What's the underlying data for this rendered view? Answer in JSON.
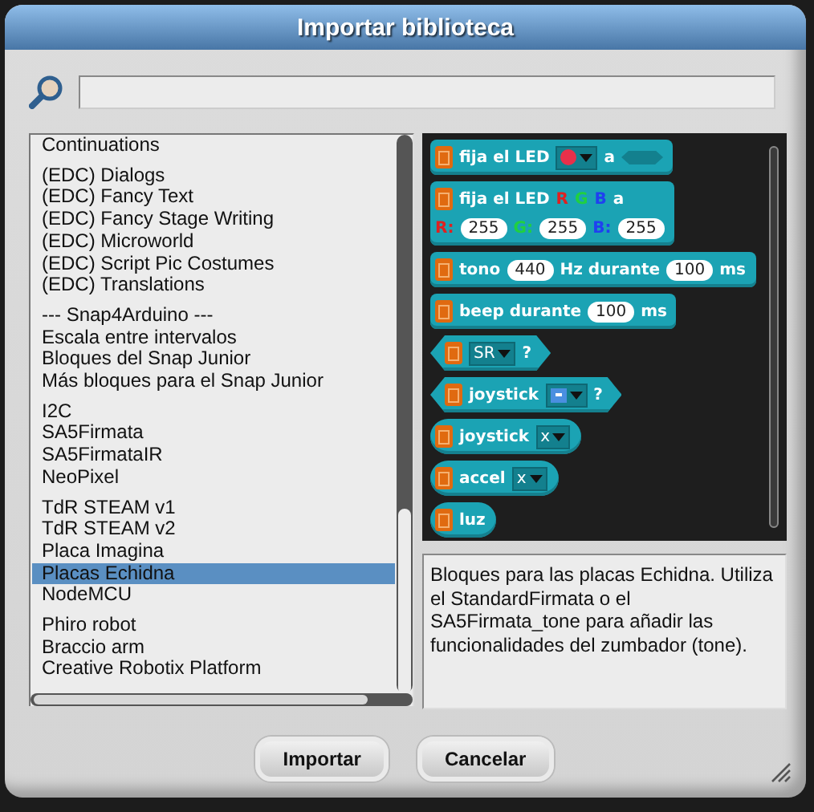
{
  "window": {
    "title": "Importar biblioteca"
  },
  "library_list": {
    "groups": [
      {
        "items": [
          {
            "label": "Continuations",
            "selected": false
          }
        ]
      },
      {
        "items": [
          {
            "label": "(EDC) Dialogs",
            "selected": false
          },
          {
            "label": "(EDC) Fancy Text",
            "selected": false
          },
          {
            "label": "(EDC) Fancy Stage Writing",
            "selected": false
          },
          {
            "label": "(EDC) Microworld",
            "selected": false
          },
          {
            "label": "(EDC) Script Pic Costumes",
            "selected": false
          },
          {
            "label": "(EDC) Translations",
            "selected": false
          }
        ]
      },
      {
        "items": [
          {
            "label": "--- Snap4Arduino ---",
            "selected": false
          },
          {
            "label": "Escala entre intervalos",
            "selected": false
          },
          {
            "label": "Bloques del Snap Junior",
            "selected": false
          },
          {
            "label": "Más bloques para el Snap Junior",
            "selected": false
          }
        ]
      },
      {
        "items": [
          {
            "label": "I2C",
            "selected": false
          },
          {
            "label": "SA5Firmata",
            "selected": false
          },
          {
            "label": "SA5FirmataIR",
            "selected": false
          },
          {
            "label": "NeoPixel",
            "selected": false
          }
        ]
      },
      {
        "items": [
          {
            "label": "TdR STEAM v1",
            "selected": false
          },
          {
            "label": "TdR STEAM v2",
            "selected": false
          },
          {
            "label": "Placa Imagina",
            "selected": false
          },
          {
            "label": "Placas Echidna",
            "selected": true
          },
          {
            "label": "NodeMCU",
            "selected": false
          }
        ]
      },
      {
        "items": [
          {
            "label": "Phiro robot",
            "selected": false
          },
          {
            "label": "Braccio arm",
            "selected": false
          },
          {
            "label": "Creative Robotix Platform",
            "selected": false
          }
        ]
      }
    ]
  },
  "blocks": [
    {
      "kind": "command",
      "lines": [
        [
          {
            "kind": "text",
            "text": "fija el LED"
          },
          {
            "kind": "color_menu",
            "color": "#e8304a"
          },
          {
            "kind": "text",
            "text": "a"
          },
          {
            "kind": "hex_slot"
          }
        ]
      ]
    },
    {
      "kind": "command",
      "lines": [
        [
          {
            "kind": "text",
            "text": "fija el LED"
          },
          {
            "kind": "label",
            "text": "R",
            "color": "#e02020"
          },
          {
            "kind": "label",
            "text": "G",
            "color": "#20d040"
          },
          {
            "kind": "label",
            "text": "B",
            "color": "#2040f0"
          },
          {
            "kind": "text",
            "text": "a"
          }
        ],
        [
          {
            "kind": "label",
            "text": "R:",
            "color": "#e02020"
          },
          {
            "kind": "slot",
            "text": "255"
          },
          {
            "kind": "label",
            "text": "G:",
            "color": "#20d040"
          },
          {
            "kind": "slot",
            "text": "255"
          },
          {
            "kind": "label",
            "text": "B:",
            "color": "#2040f0"
          },
          {
            "kind": "slot",
            "text": "255"
          }
        ]
      ]
    },
    {
      "kind": "command",
      "lines": [
        [
          {
            "kind": "text",
            "text": "tono"
          },
          {
            "kind": "slot",
            "text": "440"
          },
          {
            "kind": "text",
            "text": "Hz durante"
          },
          {
            "kind": "slot",
            "text": "100"
          },
          {
            "kind": "text",
            "text": "ms"
          }
        ]
      ]
    },
    {
      "kind": "command",
      "lines": [
        [
          {
            "kind": "text",
            "text": "beep durante"
          },
          {
            "kind": "slot",
            "text": "100"
          },
          {
            "kind": "text",
            "text": "ms"
          }
        ]
      ]
    },
    {
      "kind": "predicate",
      "lines": [
        [
          {
            "kind": "menu",
            "text": "SR"
          },
          {
            "kind": "text",
            "text": "?"
          }
        ]
      ]
    },
    {
      "kind": "predicate",
      "lines": [
        [
          {
            "kind": "text",
            "text": "joystick"
          },
          {
            "kind": "icon_menu"
          },
          {
            "kind": "text",
            "text": "?"
          }
        ]
      ]
    },
    {
      "kind": "reporter",
      "lines": [
        [
          {
            "kind": "text",
            "text": "joystick"
          },
          {
            "kind": "menu",
            "text": "x"
          }
        ]
      ]
    },
    {
      "kind": "reporter",
      "lines": [
        [
          {
            "kind": "text",
            "text": "accel"
          },
          {
            "kind": "menu",
            "text": "x"
          }
        ]
      ]
    },
    {
      "kind": "reporter",
      "lines": [
        [
          {
            "kind": "text",
            "text": "luz"
          }
        ]
      ]
    }
  ],
  "description": "Bloques para las placas Echidna. Utiliza el StandardFirmata o el SA5Firmata_tone para añadir las funcionalidades del zumbador (tone).",
  "buttons": [
    "Importar",
    "Cancelar"
  ]
}
